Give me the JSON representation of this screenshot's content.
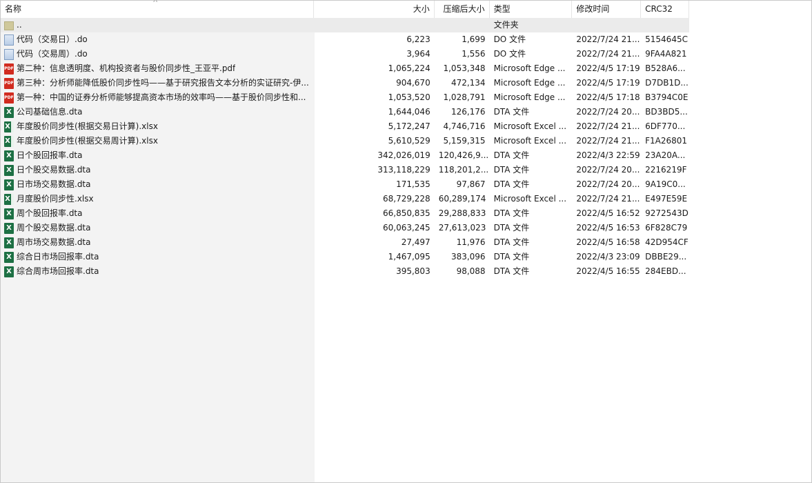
{
  "columns": {
    "name": "名称",
    "size": "大小",
    "packed": "压缩后大小",
    "type": "类型",
    "modified": "修改时间",
    "crc": "CRC32"
  },
  "sort_indicator": "^",
  "rows": [
    {
      "name": "..",
      "size": "",
      "packed": "",
      "type": "文件夹",
      "modified": "",
      "crc": "",
      "icon": "folder-icon"
    },
    {
      "name": "代码（交易日）.do",
      "size": "6,223",
      "packed": "1,699",
      "type": "DO 文件",
      "modified": "2022/7/24 21...",
      "crc": "5154645C",
      "icon": "do-file-icon"
    },
    {
      "name": "代码（交易周）.do",
      "size": "3,964",
      "packed": "1,556",
      "type": "DO 文件",
      "modified": "2022/7/24 21...",
      "crc": "9FA4A821",
      "icon": "do-file-icon"
    },
    {
      "name": "第二种：信息透明度、机构投资者与股价同步性_王亚平.pdf",
      "size": "1,065,224",
      "packed": "1,053,348",
      "type": "Microsoft Edge ...",
      "modified": "2022/4/5 17:19",
      "crc": "B528A6...",
      "icon": "pdf-icon"
    },
    {
      "name": "第三种：分析师能降低股价同步性吗——基于研究报告文本分析的实证研究-伊...",
      "size": "904,670",
      "packed": "472,134",
      "type": "Microsoft Edge ...",
      "modified": "2022/4/5 17:19",
      "crc": "D7DB1D...",
      "icon": "pdf-icon"
    },
    {
      "name": "第一种：中国的证券分析师能够提高资本市场的效率吗——基于股价同步性和...",
      "size": "1,053,520",
      "packed": "1,028,791",
      "type": "Microsoft Edge ...",
      "modified": "2022/4/5 17:18",
      "crc": "B3794C0E",
      "icon": "pdf-icon"
    },
    {
      "name": "公司基础信息.dta",
      "size": "1,644,046",
      "packed": "126,176",
      "type": "DTA 文件",
      "modified": "2022/7/24 20...",
      "crc": "BD3BD5...",
      "icon": "excel-icon"
    },
    {
      "name": "年度股价同步性(根据交易日计算).xlsx",
      "size": "5,172,247",
      "packed": "4,746,716",
      "type": "Microsoft Excel ...",
      "modified": "2022/7/24 21...",
      "crc": "6DF770...",
      "icon": "xlsx-icon"
    },
    {
      "name": "年度股价同步性(根据交易周计算).xlsx",
      "size": "5,610,529",
      "packed": "5,159,315",
      "type": "Microsoft Excel ...",
      "modified": "2022/7/24 21...",
      "crc": "F1A26801",
      "icon": "xlsx-icon"
    },
    {
      "name": "日个股回报率.dta",
      "size": "342,026,019",
      "packed": "120,426,9...",
      "type": "DTA 文件",
      "modified": "2022/4/3 22:59",
      "crc": "23A20A...",
      "icon": "excel-icon"
    },
    {
      "name": "日个股交易数据.dta",
      "size": "313,118,229",
      "packed": "118,201,2...",
      "type": "DTA 文件",
      "modified": "2022/7/24 20...",
      "crc": "2216219F",
      "icon": "excel-icon"
    },
    {
      "name": "日市场交易数据.dta",
      "size": "171,535",
      "packed": "97,867",
      "type": "DTA 文件",
      "modified": "2022/7/24 20...",
      "crc": "9A19C0...",
      "icon": "excel-icon"
    },
    {
      "name": "月度股价同步性.xlsx",
      "size": "68,729,228",
      "packed": "60,289,174",
      "type": "Microsoft Excel ...",
      "modified": "2022/7/24 21...",
      "crc": "E497E59E",
      "icon": "xlsx-icon"
    },
    {
      "name": "周个股回报率.dta",
      "size": "66,850,835",
      "packed": "29,288,833",
      "type": "DTA 文件",
      "modified": "2022/4/5 16:52",
      "crc": "9272543D",
      "icon": "excel-icon"
    },
    {
      "name": "周个股交易数据.dta",
      "size": "60,063,245",
      "packed": "27,613,023",
      "type": "DTA 文件",
      "modified": "2022/4/5 16:53",
      "crc": "6F828C79",
      "icon": "excel-icon"
    },
    {
      "name": "周市场交易数据.dta",
      "size": "27,497",
      "packed": "11,976",
      "type": "DTA 文件",
      "modified": "2022/4/5 16:58",
      "crc": "42D954CF",
      "icon": "excel-icon"
    },
    {
      "name": "综合日市场回报率.dta",
      "size": "1,467,095",
      "packed": "383,096",
      "type": "DTA 文件",
      "modified": "2022/4/3 23:09",
      "crc": "DBBE29...",
      "icon": "excel-icon"
    },
    {
      "name": "综合周市场回报率.dta",
      "size": "395,803",
      "packed": "98,088",
      "type": "DTA 文件",
      "modified": "2022/4/5 16:55",
      "crc": "284EBD...",
      "icon": "excel-icon"
    }
  ]
}
